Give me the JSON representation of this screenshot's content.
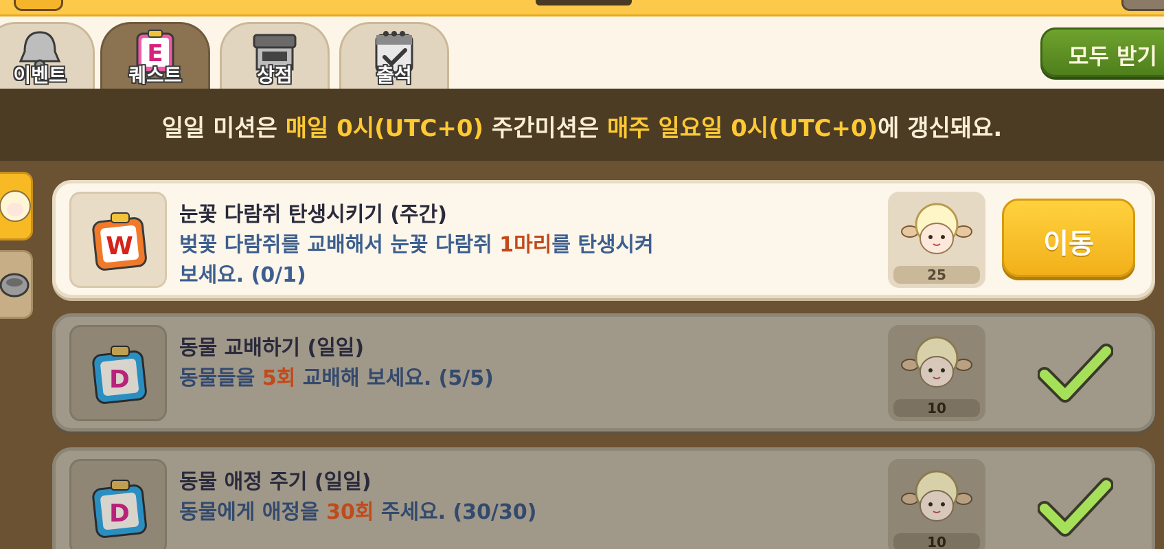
{
  "tabs": [
    {
      "label": "이벤트",
      "icon": "bell-icon",
      "active": false
    },
    {
      "label": "퀘스트",
      "icon": "quest-clipboard-icon",
      "active": true
    },
    {
      "label": "상점",
      "icon": "shop-stall-icon",
      "active": false
    },
    {
      "label": "출석",
      "icon": "calendar-check-icon",
      "active": false
    }
  ],
  "claim_all_label": "모두 받기",
  "notice": {
    "p1": "일일 미션은 ",
    "h1": "매일 0시(UTC+0)",
    "p2": " 주간미션은 ",
    "h2": "매주 일요일 0시(UTC+0)",
    "p3": "에 갱신돼요."
  },
  "quests": [
    {
      "badge": "W",
      "title": "눈꽃 다람쥐 탄생시키기 (주간)",
      "desc_pre": "벚꽃 다람쥐를 교배해서 눈꽃 다람쥐 ",
      "desc_num": "1마리",
      "desc_post": "를 탄생시켜 보세요. (0/1)",
      "reward_count": "25",
      "action_label": "이동",
      "completed": false
    },
    {
      "badge": "D",
      "title": "동물 교배하기 (일일)",
      "desc_pre": "동물들을 ",
      "desc_num": "5회",
      "desc_post": " 교배해 보세요. (5/5)",
      "reward_count": "10",
      "completed": true
    },
    {
      "badge": "D",
      "title": "동물 애정 주기 (일일)",
      "desc_pre": "동물에게 애정을 ",
      "desc_num": "30회",
      "desc_post": " 주세요. (30/30)",
      "reward_count": "10",
      "completed": true
    }
  ],
  "colors": {
    "highlight": "#ffc933",
    "count_red": "#c14a1a",
    "claim_green": "#5b8f24",
    "go_yellow": "#f7c02a",
    "check_green": "#a6e05a"
  }
}
